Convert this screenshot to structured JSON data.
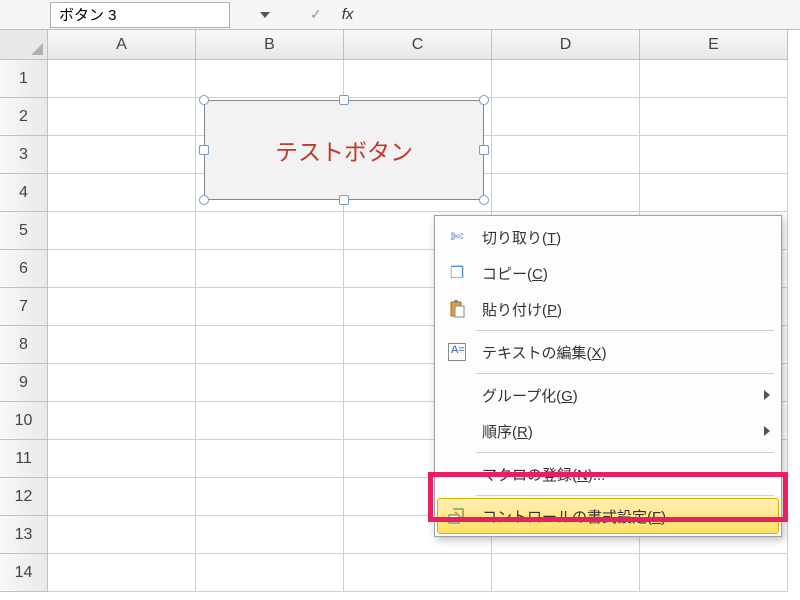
{
  "name_box": {
    "value": "ボタン 3"
  },
  "formula_bar": {
    "fx_label": "fx"
  },
  "columns": [
    "A",
    "B",
    "C",
    "D",
    "E"
  ],
  "rows": [
    "1",
    "2",
    "3",
    "4",
    "5",
    "6",
    "7",
    "8",
    "9",
    "10",
    "11",
    "12",
    "13",
    "14"
  ],
  "button_control": {
    "label": "テストボタン"
  },
  "context_menu": {
    "items": [
      {
        "icon": "✂",
        "label_pre": "切り取り(",
        "mnemonic": "T",
        "label_post": ")"
      },
      {
        "icon": "⎘",
        "label_pre": "コピー(",
        "mnemonic": "C",
        "label_post": ")"
      },
      {
        "icon": "📋",
        "label_pre": "貼り付け(",
        "mnemonic": "P",
        "label_post": ")"
      },
      {
        "icon": "A",
        "label_pre": "テキストの編集(",
        "mnemonic": "X",
        "label_post": ")"
      },
      {
        "label_pre": "グループ化(",
        "mnemonic": "G",
        "label_post": ")",
        "submenu": true
      },
      {
        "label_pre": "順序(",
        "mnemonic": "R",
        "label_post": ")",
        "submenu": true
      },
      {
        "label_pre": "マクロの登録(",
        "mnemonic": "N",
        "label_post": ")..."
      },
      {
        "icon": "🔧",
        "label_pre": "コントロールの書式設定(",
        "mnemonic": "F",
        "label_post": ")...",
        "highlighted": true
      }
    ]
  }
}
